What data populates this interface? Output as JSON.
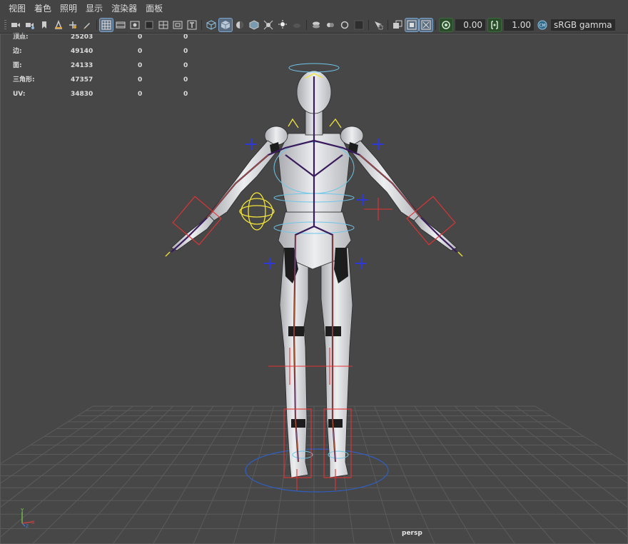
{
  "menubar": {
    "items": [
      "视图",
      "着色",
      "照明",
      "显示",
      "渲染器",
      "面板"
    ]
  },
  "toolbar": {
    "exposure_value": "0.00",
    "gamma_value": "1.00",
    "color_space": "sRGB gamma",
    "icons": [
      "camera-select-icon",
      "camera-attributes-icon",
      "bookmark-icon",
      "image-plane-icon",
      "2d-pan-zoom-icon",
      "grease-pencil-icon",
      "grid-icon",
      "film-gate-icon",
      "resolution-gate-icon",
      "gate-mask-icon",
      "field-chart-icon",
      "safe-action-icon",
      "safe-title-icon",
      "wireframe-icon",
      "smooth-shade-icon",
      "default-material-icon",
      "textured-icon",
      "use-lights-icon",
      "shadows-icon",
      "ambient-occlusion-icon",
      "motion-blur-icon",
      "multisample-icon",
      "depth-of-field-icon",
      "hardware-fog-icon",
      "isolate-select-icon",
      "xray-icon",
      "xray-active-icon",
      "xray-joints-icon",
      "exposure-icon",
      "gamma-icon",
      "color-management-icon"
    ]
  },
  "hud": {
    "rows": [
      {
        "label": "顶点:",
        "v1": "25203",
        "v2": "0",
        "v3": "0"
      },
      {
        "label": "边:",
        "v1": "49140",
        "v2": "0",
        "v3": "0"
      },
      {
        "label": "面:",
        "v1": "24133",
        "v2": "0",
        "v3": "0"
      },
      {
        "label": "三角形:",
        "v1": "47357",
        "v2": "0",
        "v3": "0"
      },
      {
        "label": "UV:",
        "v1": "34830",
        "v2": "0",
        "v3": "0"
      }
    ]
  },
  "viewport": {
    "camera": "persp",
    "axis_labels": {
      "y": "Y",
      "x": "X",
      "z": "Z"
    }
  },
  "colors": {
    "background": "#474747",
    "grid": "#585858",
    "mesh": "#d9dadc",
    "joint": "#3a1c5c",
    "control_blue": "#2f3ad6",
    "control_red": "#e23333",
    "control_yellow": "#f2e33a",
    "control_cyan": "#6fc6e8",
    "active_button": "#5a6c80"
  }
}
